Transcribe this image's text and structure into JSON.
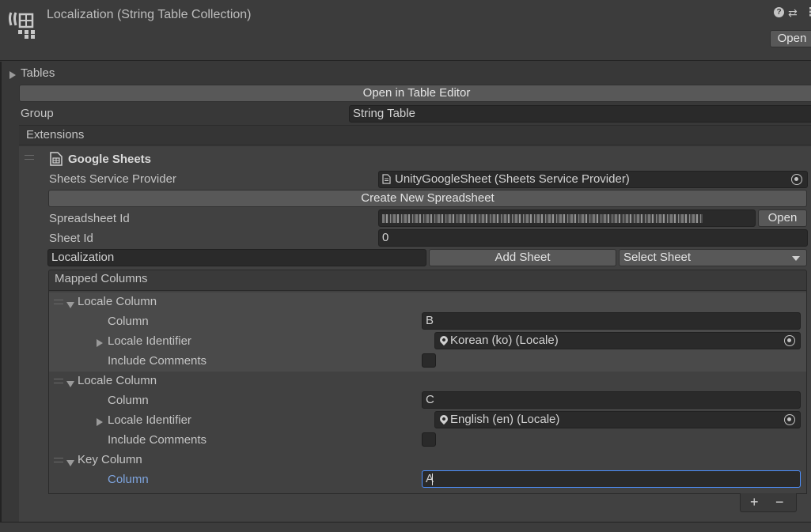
{
  "header": {
    "title": "Localization (String Table Collection)",
    "open_label": "Open",
    "help_icon": "?",
    "settings_icon": "⇄",
    "menu_icon": "⋮"
  },
  "tables": {
    "foldout_label": "Tables",
    "open_table_editor_label": "Open in Table Editor",
    "group_label": "Group",
    "group_value": "String Table",
    "extensions_label": "Extensions"
  },
  "google_sheets": {
    "title": "Google Sheets",
    "provider_label": "Sheets Service Provider",
    "provider_value": "UnityGoogleSheet (Sheets Service Provider)",
    "create_spreadsheet_label": "Create New Spreadsheet",
    "spreadsheet_id_label": "Spreadsheet Id",
    "spreadsheet_open_label": "Open",
    "sheet_id_label": "Sheet Id",
    "sheet_id_value": "0",
    "new_sheet_name_value": "Localization",
    "add_sheet_label": "Add Sheet",
    "select_sheet_label": "Select Sheet"
  },
  "mapped_columns": {
    "title": "Mapped Columns",
    "items": [
      {
        "type_label": "Locale Column",
        "column_label": "Column",
        "column_value": "B",
        "locale_identifier_label": "Locale Identifier",
        "locale_value": "Korean (ko) (Locale)",
        "include_comments_label": "Include Comments",
        "include_comments": false
      },
      {
        "type_label": "Locale Column",
        "column_label": "Column",
        "column_value": "C",
        "locale_identifier_label": "Locale Identifier",
        "locale_value": "English (en) (Locale)",
        "include_comments_label": "Include Comments",
        "include_comments": false
      },
      {
        "type_label": "Key Column",
        "column_label": "Column",
        "column_value": "A"
      }
    ],
    "add_label": "+",
    "remove_label": "−"
  },
  "colors": {
    "background": "#383838",
    "field": "#2a2a2a",
    "button": "#585858",
    "accent": "#4d90ff",
    "focused_label": "#7ea4de"
  }
}
